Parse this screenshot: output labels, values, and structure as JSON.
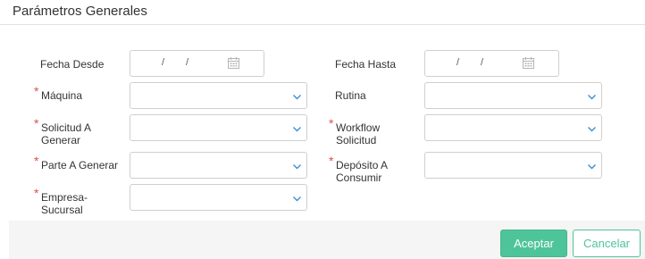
{
  "dialog": {
    "title": "Parámetros Generales"
  },
  "fields": {
    "fecha_desde": {
      "label": "Fecha Desde",
      "required": false,
      "date_sep": "/"
    },
    "fecha_hasta": {
      "label": "Fecha Hasta",
      "required": false,
      "date_sep": "/"
    },
    "maquina": {
      "label": "Máquina",
      "required": true,
      "value": ""
    },
    "rutina": {
      "label": "Rutina",
      "required": false,
      "value": ""
    },
    "solicitud_a_generar": {
      "label_line1": "Solicitud A",
      "label_line2": "Generar",
      "required": true,
      "value": ""
    },
    "workflow_solicitud": {
      "label_line1": "Workflow",
      "label_line2": "Solicitud",
      "required": true,
      "value": ""
    },
    "parte_a_generar": {
      "label": "Parte A Generar",
      "required": true,
      "value": ""
    },
    "deposito_a_consumir": {
      "label_line1": "Depósito A",
      "label_line2": "Consumir",
      "required": true,
      "value": ""
    },
    "empresa_sucursal": {
      "label_line1": "Empresa-",
      "label_line2": "Sucursal",
      "required": true,
      "value": ""
    }
  },
  "required_marker": "*",
  "footer": {
    "accept_label": "Aceptar",
    "cancel_label": "Cancelar"
  },
  "icons": {
    "date": "calendar-icon",
    "select": "chevron-down-icon"
  },
  "colors": {
    "accent": "#4ec49a",
    "required": "#d9534f",
    "chevron": "#3a8fd6"
  }
}
